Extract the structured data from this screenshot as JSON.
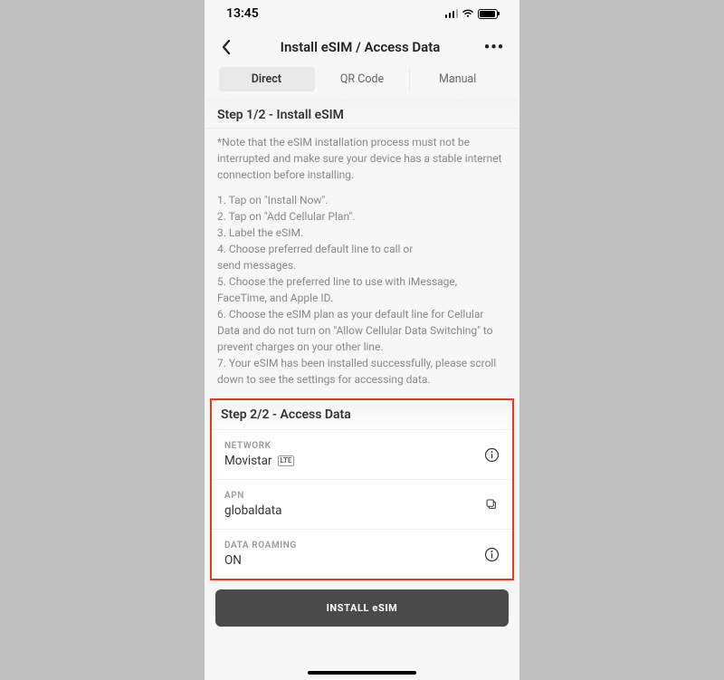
{
  "status": {
    "time": "13:45"
  },
  "nav": {
    "title": "Install eSIM / Access Data"
  },
  "tabs": {
    "direct": "Direct",
    "qrcode": "QR Code",
    "manual": "Manual"
  },
  "step1": {
    "header": "Step 1/2 - Install eSIM",
    "note": "*Note that the eSIM installation process must not be interrupted and make sure your device has a stable internet connection before installing.",
    "list": "1. Tap on \"Install Now\".\n2. Tap on \"Add Cellular Plan\".\n3. Label the eSIM.\n4. Choose preferred default line to call or\nsend messages.\n5. Choose the preferred line to use with iMessage, FaceTime, and Apple ID.\n6. Choose the eSIM plan as your default line for Cellular Data and do not turn on \"Allow Cellular Data Switching\" to prevent charges on your other line.\n7. Your eSIM has been installed successfully, please scroll down to see the settings for accessing data."
  },
  "step2": {
    "header": "Step 2/2 - Access Data",
    "network": {
      "label": "NETWORK",
      "value": "Movistar",
      "badge": "LTE"
    },
    "apn": {
      "label": "APN",
      "value": "globaldata"
    },
    "roaming": {
      "label": "DATA ROAMING",
      "value": "ON"
    }
  },
  "install_button": "INSTALL eSIM"
}
